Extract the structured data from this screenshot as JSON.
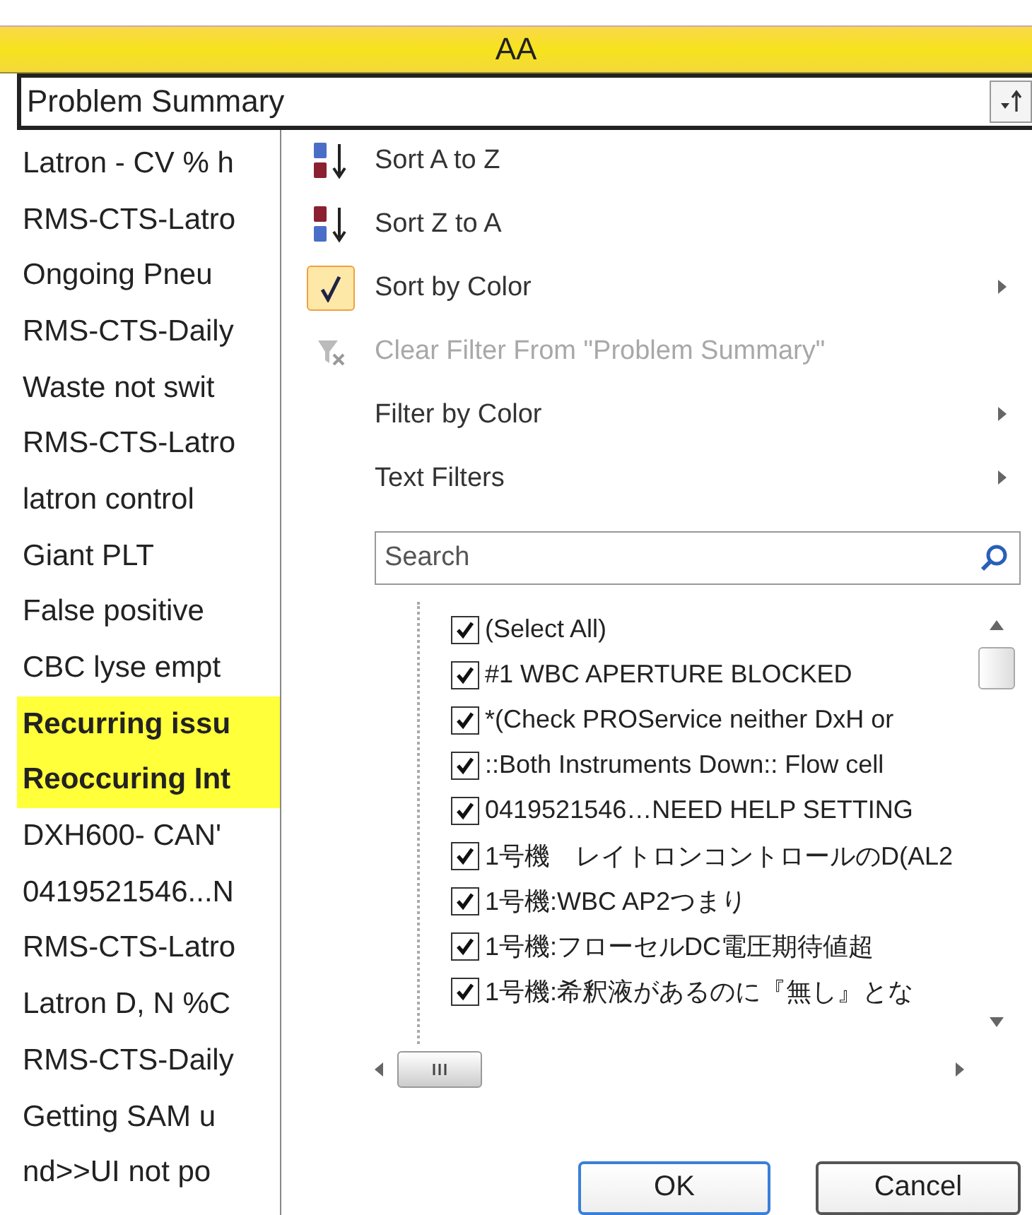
{
  "column_header": "AA",
  "header_cell": {
    "label": "Problem Summary"
  },
  "cells": [
    {
      "text": "Latron - CV % h",
      "highlighted": false
    },
    {
      "text": "RMS-CTS-Latro",
      "highlighted": false
    },
    {
      "text": "Ongoing Pneu",
      "highlighted": false
    },
    {
      "text": "RMS-CTS-Daily",
      "highlighted": false
    },
    {
      "text": "Waste not swit",
      "highlighted": false
    },
    {
      "text": "RMS-CTS-Latro",
      "highlighted": false
    },
    {
      "text": "latron control",
      "highlighted": false
    },
    {
      "text": "Giant PLT",
      "highlighted": false
    },
    {
      "text": "False positive",
      "highlighted": false
    },
    {
      "text": "CBC lyse empt",
      "highlighted": false
    },
    {
      "text": "Recurring issu",
      "highlighted": true
    },
    {
      "text": "Reoccuring Int",
      "highlighted": true
    },
    {
      "text": "DXH600- CAN'",
      "highlighted": false
    },
    {
      "text": "0419521546...N",
      "highlighted": false
    },
    {
      "text": "RMS-CTS-Latro",
      "highlighted": false
    },
    {
      "text": "Latron D, N %C",
      "highlighted": false
    },
    {
      "text": "RMS-CTS-Daily",
      "highlighted": false
    },
    {
      "text": "Getting SAM u",
      "highlighted": false
    },
    {
      "text": "nd>>UI not po",
      "highlighted": false
    }
  ],
  "menu": {
    "items": [
      {
        "kind": "sort_az",
        "label": "Sort A to Z",
        "disabled": false,
        "submenu": false
      },
      {
        "kind": "sort_za",
        "label": "Sort Z to A",
        "disabled": false,
        "submenu": false
      },
      {
        "kind": "checked",
        "label": "Sort by Color",
        "disabled": false,
        "submenu": true
      },
      {
        "kind": "clear",
        "label": "Clear Filter From \"Problem Summary\"",
        "disabled": true,
        "submenu": false
      },
      {
        "kind": "plain",
        "label": "Filter by Color",
        "disabled": false,
        "submenu": true
      },
      {
        "kind": "plain",
        "label": "Text Filters",
        "disabled": false,
        "submenu": true
      }
    ]
  },
  "search": {
    "placeholder": "Search"
  },
  "filter_list": [
    {
      "label": "(Select All)",
      "checked": true
    },
    {
      "label": "#1 WBC APERTURE BLOCKED",
      "checked": true
    },
    {
      "label": "*(Check PROService neither DxH or",
      "checked": true
    },
    {
      "label": "::Both Instruments Down:: Flow cell",
      "checked": true
    },
    {
      "label": "0419521546…NEED HELP SETTING",
      "checked": true
    },
    {
      "label": "1号機　レイトロンコントロールのD(AL2",
      "checked": true
    },
    {
      "label": "1号機:WBC AP2つまり",
      "checked": true
    },
    {
      "label": "1号機:フローセルDC電圧期待値超",
      "checked": true
    },
    {
      "label": "1号機:希釈液があるのに『無し』とな",
      "checked": true
    }
  ],
  "buttons": [
    {
      "label": "OK",
      "default": true
    },
    {
      "label": "Cancel",
      "default": false
    }
  ]
}
